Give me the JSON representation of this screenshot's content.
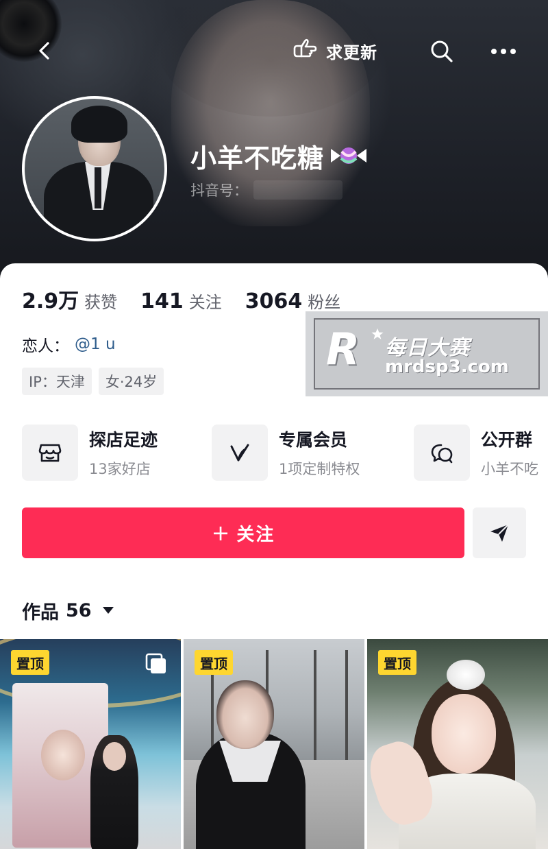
{
  "header": {
    "back_label": "",
    "request_update_label": "求更新",
    "nickname": "小羊不吃糖",
    "douyin_id_label": "抖音号：",
    "douyin_id_value": "",
    "nickname_emoji": "candy-icon"
  },
  "stats": [
    {
      "value": "2.9万",
      "label": "获赞"
    },
    {
      "value": "141",
      "label": "关注"
    },
    {
      "value": "3064",
      "label": "粉丝"
    }
  ],
  "profile": {
    "lover_label": "恋人：",
    "lover_link": "@1 u",
    "tags": [
      "IP：天津",
      "女·24岁"
    ]
  },
  "watermark": {
    "brand_cn": "每日大赛",
    "brand_url": "mrdsp3.com",
    "brand_letter": "R"
  },
  "services": [
    {
      "title": "探店足迹",
      "subtitle": "13家好店",
      "icon": "shop-icon"
    },
    {
      "title": "专属会员",
      "subtitle": "1项定制特权",
      "icon": "member-v-icon"
    },
    {
      "title": "公开群",
      "subtitle": "小羊不吃",
      "icon": "group-chat-icon"
    }
  ],
  "actions": {
    "follow_plus": "+",
    "follow_label": "关注",
    "share_icon": "send-icon"
  },
  "works": {
    "label": "作品",
    "count": "56",
    "items": [
      {
        "pinned_label": "置顶",
        "multi_image": true
      },
      {
        "pinned_label": "置顶",
        "multi_image": false
      },
      {
        "pinned_label": "置顶",
        "multi_image": false
      }
    ]
  },
  "colors": {
    "accent": "#fe2c55",
    "pin_badge": "#fed630",
    "link": "#2f5d8c"
  }
}
